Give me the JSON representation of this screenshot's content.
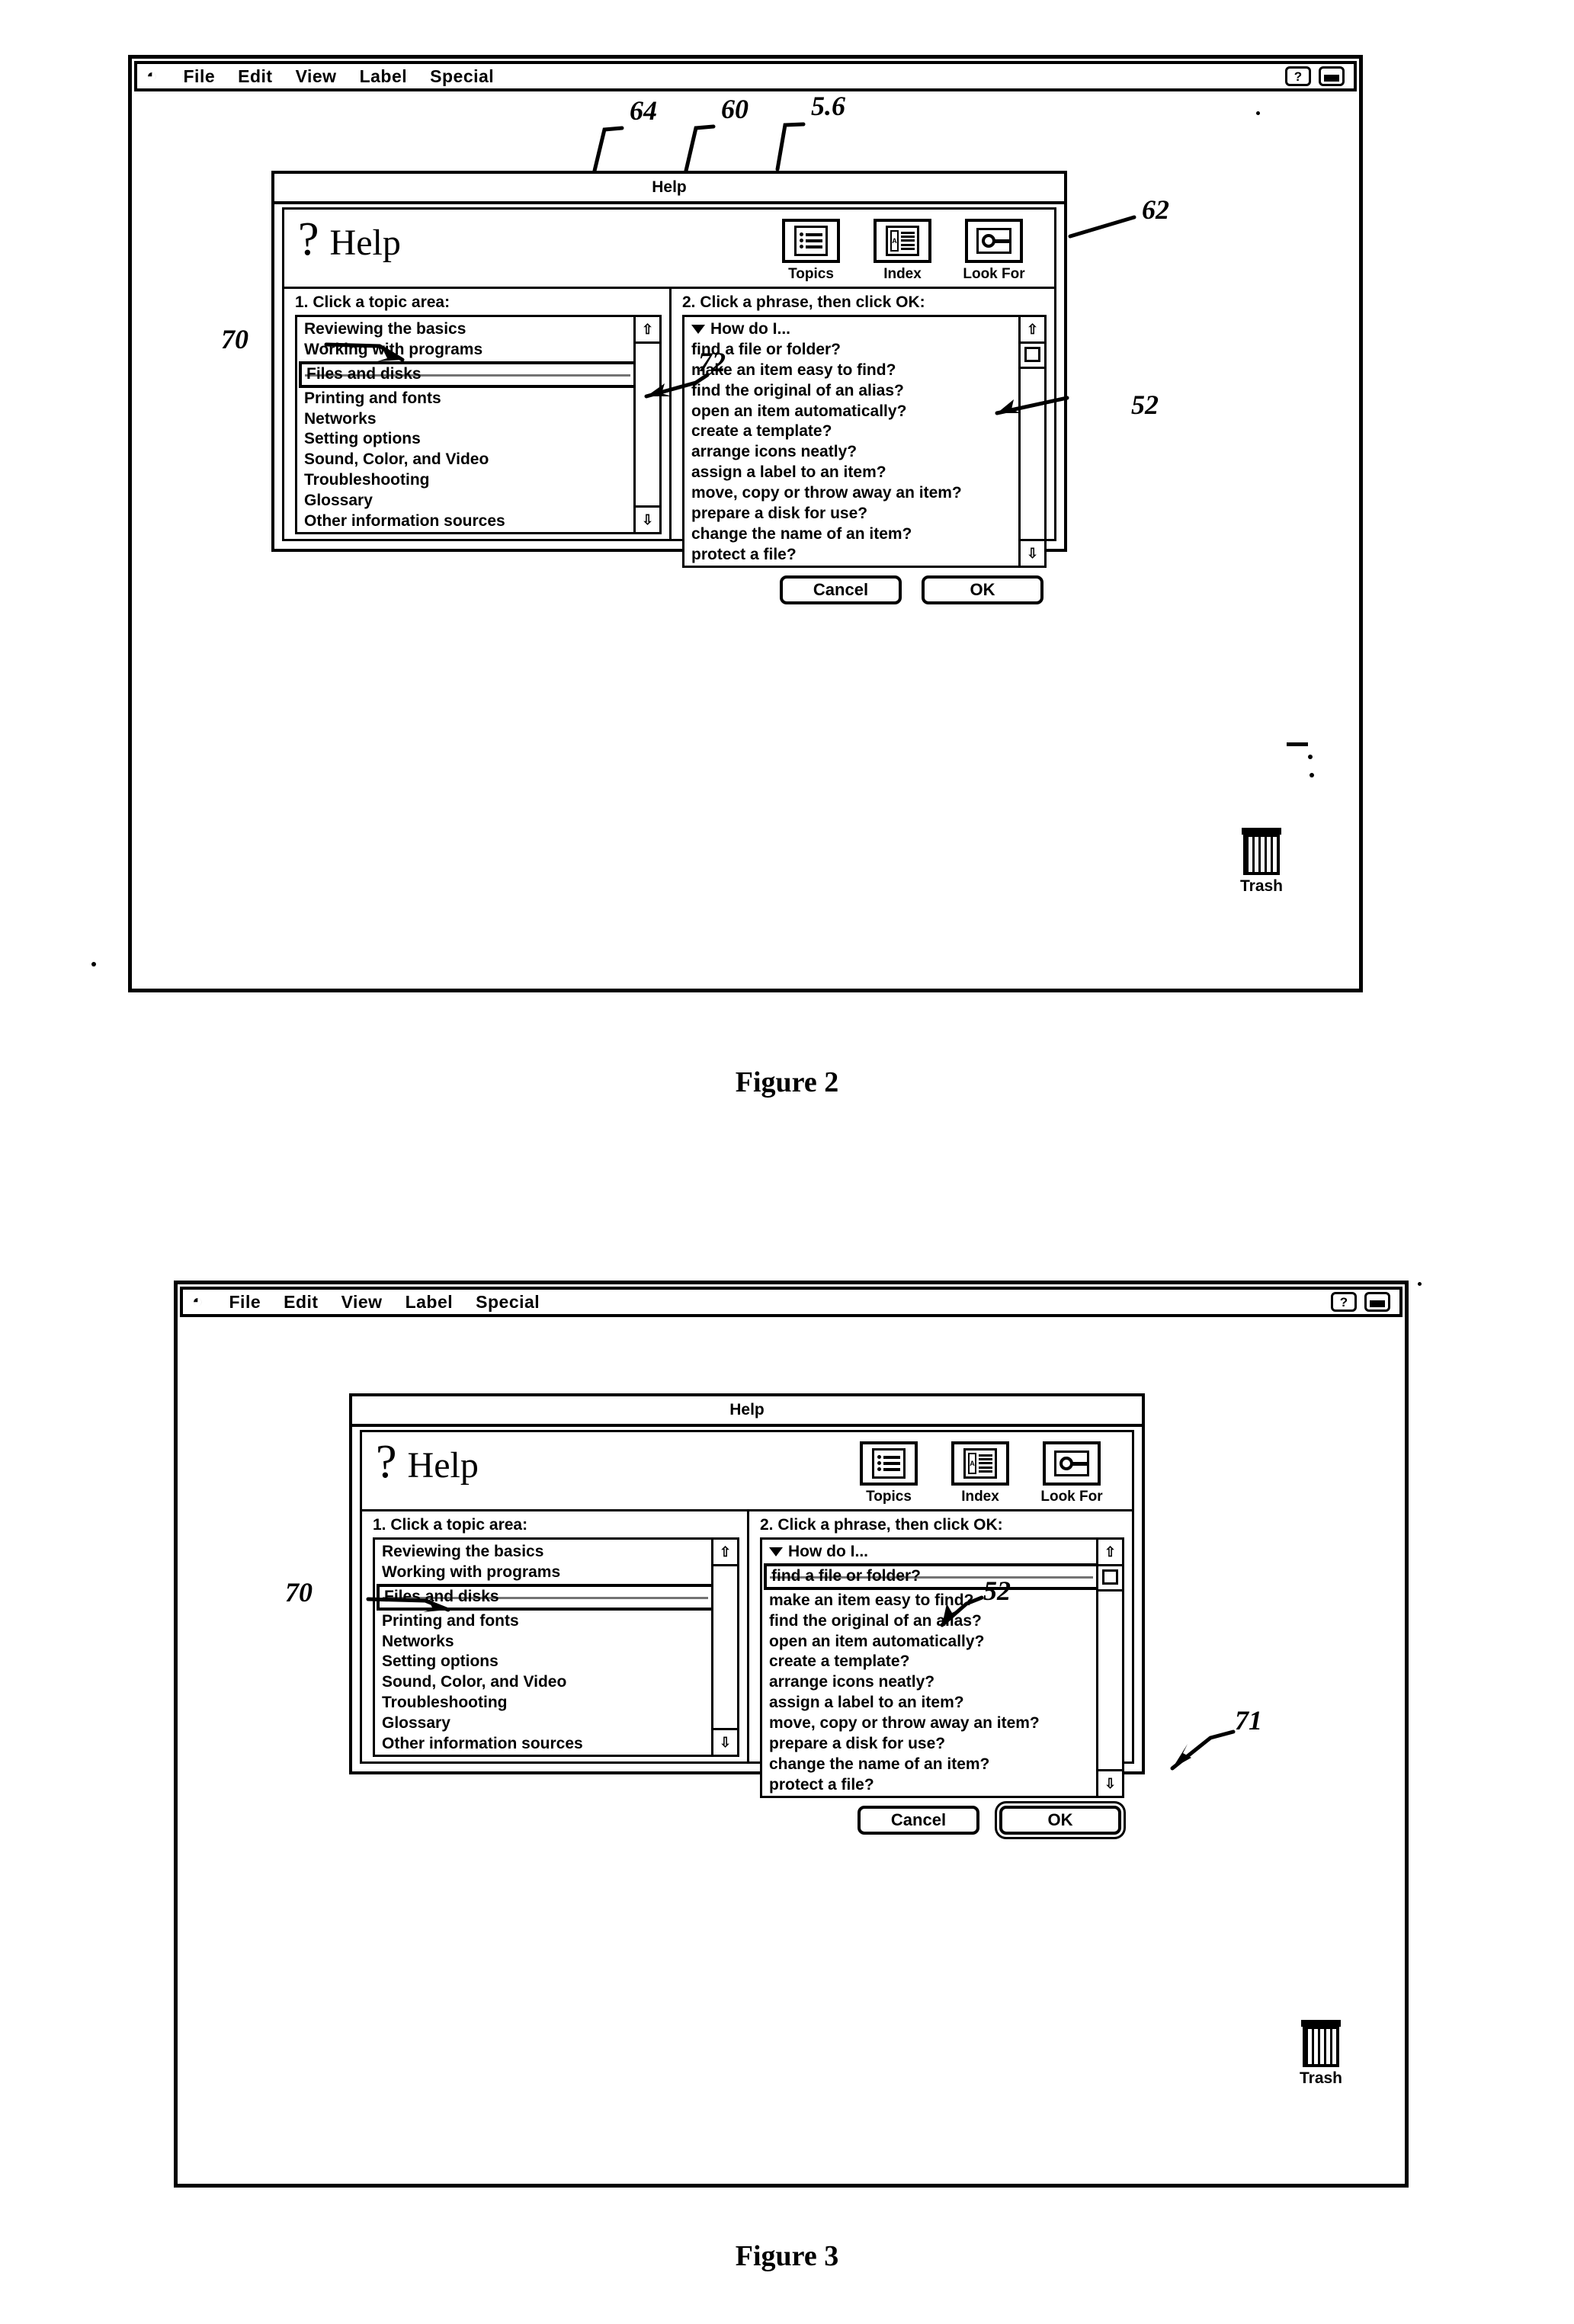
{
  "page": {
    "figure2_caption": "Figure 2",
    "figure3_caption": "Figure 3"
  },
  "menubar": {
    "apple_icon": "apple-icon",
    "items": [
      "File",
      "Edit",
      "View",
      "Label",
      "Special"
    ],
    "right_icons": [
      "help-question-icon",
      "application-switcher-icon"
    ],
    "help_glyph": "?"
  },
  "help_window": {
    "title": "Help",
    "brand_qmark": "?",
    "brand_word": "Help",
    "toolbar": [
      {
        "label": "Topics",
        "icon": "topics-list-icon"
      },
      {
        "label": "Index",
        "icon": "index-document-icon"
      },
      {
        "label": "Look For",
        "icon": "look-for-search-icon"
      }
    ],
    "left_pane": {
      "label": "1. Click a topic area:",
      "items": [
        "Reviewing the basics",
        "Working with programs",
        "Files and disks",
        "Printing and fonts",
        "Networks",
        "Setting options",
        "Sound, Color, and Video",
        "Troubleshooting",
        "Glossary",
        "Other information sources"
      ],
      "selected_index": 2
    },
    "right_pane": {
      "label": "2. Click a phrase, then click OK:",
      "root_item": "How do I...",
      "items": [
        "find a file or folder?",
        "make an item easy to find?",
        "find the original of an alias?",
        "open an item automatically?",
        "create a template?",
        "arrange icons neatly?",
        "assign a label to an item?",
        "move, copy or throw away an item?",
        "prepare a disk for use?",
        "change the name of an item?",
        "protect a file?"
      ],
      "selected_index_fig2": -1,
      "selected_index_fig3": 0
    },
    "buttons": {
      "cancel": "Cancel",
      "ok": "OK"
    },
    "scrollbar": {
      "up_arrow": "⇧",
      "down_arrow": "⇩"
    }
  },
  "desktop": {
    "trash_label": "Trash",
    "trash_icon": "trash-can-icon"
  },
  "figure2": {
    "callouts": [
      {
        "id": "c64",
        "text": "64",
        "target": "topics-button"
      },
      {
        "id": "c60",
        "text": "60",
        "target": "index-button"
      },
      {
        "id": "c56",
        "text": "5.6",
        "target": "look-for-button"
      },
      {
        "id": "c62",
        "text": "62",
        "target": "right-pane"
      },
      {
        "id": "c52",
        "text": "52",
        "target": "phrase-list"
      },
      {
        "id": "c70",
        "text": "70",
        "target": "selected-topic"
      },
      {
        "id": "c72",
        "text": "72",
        "target": "topic-list"
      }
    ]
  },
  "figure3": {
    "callouts": [
      {
        "id": "c70b",
        "text": "70",
        "target": "selected-topic"
      },
      {
        "id": "c52b",
        "text": "52",
        "target": "selected-phrase"
      },
      {
        "id": "c71",
        "text": "71",
        "target": "ok-button"
      }
    ]
  }
}
